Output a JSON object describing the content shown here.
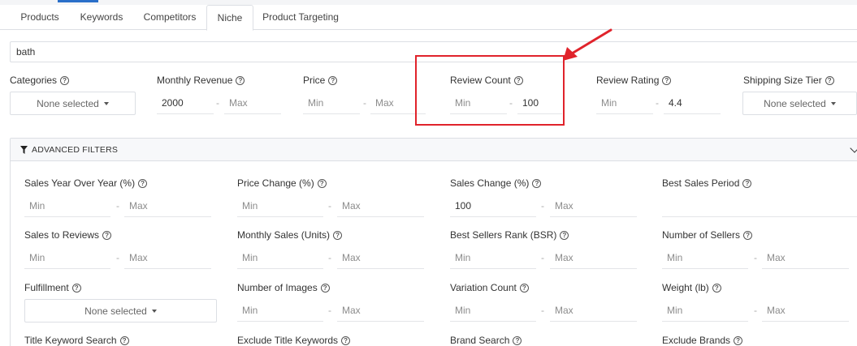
{
  "tabs": [
    "Products",
    "Keywords",
    "Competitors",
    "Niche",
    "Product Targeting"
  ],
  "active_tab": "Niche",
  "keyword": {
    "value": "bath"
  },
  "placeholders": {
    "min": "Min",
    "max": "Max"
  },
  "dash": "-",
  "none_selected": "None selected",
  "filters": {
    "categories": {
      "label": "Categories"
    },
    "monthly_revenue": {
      "label": "Monthly Revenue",
      "min": "2000",
      "max": ""
    },
    "price": {
      "label": "Price",
      "min": "",
      "max": ""
    },
    "review_count": {
      "label": "Review Count",
      "min": "",
      "max": "100"
    },
    "review_rating": {
      "label": "Review Rating",
      "min": "",
      "max": "4.4"
    },
    "shipping_size_tier": {
      "label": "Shipping Size Tier"
    }
  },
  "advanced": {
    "title": "ADVANCED FILTERS",
    "sales_yoy": {
      "label": "Sales Year Over Year (%)",
      "min": "",
      "max": ""
    },
    "price_change": {
      "label": "Price Change (%)",
      "min": "",
      "max": ""
    },
    "sales_change": {
      "label": "Sales Change (%)",
      "min": "100",
      "max": ""
    },
    "best_sales_period": {
      "label": "Best Sales Period"
    },
    "sales_to_reviews": {
      "label": "Sales to Reviews",
      "min": "",
      "max": ""
    },
    "monthly_sales_units": {
      "label": "Monthly Sales (Units)",
      "min": "",
      "max": ""
    },
    "bsr": {
      "label": "Best Sellers Rank (BSR)",
      "min": "",
      "max": ""
    },
    "number_of_sellers": {
      "label": "Number of Sellers",
      "min": "",
      "max": ""
    },
    "fulfillment": {
      "label": "Fulfillment"
    },
    "number_of_images": {
      "label": "Number of Images",
      "min": "",
      "max": ""
    },
    "variation_count": {
      "label": "Variation Count",
      "min": "",
      "max": ""
    },
    "weight": {
      "label": "Weight (lb)",
      "min": "",
      "max": ""
    },
    "title_keyword_search": {
      "label": "Title Keyword Search"
    },
    "exclude_title_keywords": {
      "label": "Exclude Title Keywords"
    },
    "brand_search": {
      "label": "Brand Search"
    },
    "exclude_brands": {
      "label": "Exclude Brands"
    }
  },
  "colors": {
    "highlight": "#e0232b",
    "accent": "#2a6fc9",
    "border": "#dcdfe4"
  },
  "icons": [
    "question-circle-icon",
    "caret-down-icon",
    "filter-funnel-icon",
    "chevron-down-icon",
    "red-arrow-annotation"
  ]
}
